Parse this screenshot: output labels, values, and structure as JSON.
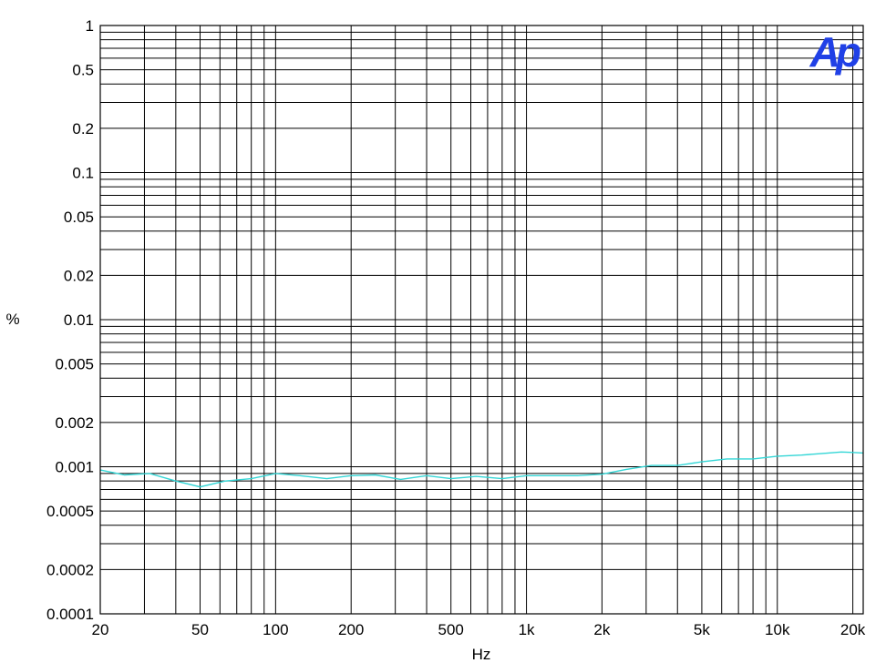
{
  "chart_data": {
    "type": "line",
    "title": "",
    "xlabel": "Hz",
    "ylabel": "%",
    "x_scale": "log",
    "y_scale": "log",
    "xlim": [
      20,
      22000
    ],
    "ylim": [
      0.0001,
      1
    ],
    "grid": true,
    "logo": "Ap",
    "x_ticks": [
      {
        "value": 20,
        "label": "20"
      },
      {
        "value": 50,
        "label": "50"
      },
      {
        "value": 100,
        "label": "100"
      },
      {
        "value": 200,
        "label": "200"
      },
      {
        "value": 500,
        "label": "500"
      },
      {
        "value": 1000,
        "label": "1k"
      },
      {
        "value": 2000,
        "label": "2k"
      },
      {
        "value": 5000,
        "label": "5k"
      },
      {
        "value": 10000,
        "label": "10k"
      },
      {
        "value": 20000,
        "label": "20k"
      }
    ],
    "y_ticks": [
      {
        "value": 1,
        "label": "1"
      },
      {
        "value": 0.5,
        "label": "0.5"
      },
      {
        "value": 0.2,
        "label": "0.2"
      },
      {
        "value": 0.1,
        "label": "0.1"
      },
      {
        "value": 0.05,
        "label": "0.05"
      },
      {
        "value": 0.02,
        "label": "0.02"
      },
      {
        "value": 0.01,
        "label": "0.01"
      },
      {
        "value": 0.005,
        "label": "0.005"
      },
      {
        "value": 0.002,
        "label": "0.002"
      },
      {
        "value": 0.001,
        "label": "0.001"
      },
      {
        "value": 0.0005,
        "label": "0.0005"
      },
      {
        "value": 0.0002,
        "label": "0.0002"
      },
      {
        "value": 0.0001,
        "label": "0.0001"
      }
    ],
    "series": [
      {
        "color": "#33d6d6",
        "x": [
          20,
          25,
          31.5,
          40,
          50,
          63,
          80,
          100,
          125,
          160,
          200,
          250,
          315,
          400,
          500,
          630,
          800,
          1000,
          1250,
          1600,
          2000,
          2500,
          3150,
          4000,
          5000,
          6300,
          8000,
          10000,
          12500,
          16000,
          18000,
          20000,
          22000
        ],
        "y": [
          0.00095,
          0.00088,
          0.0009,
          0.0008,
          0.00073,
          0.0008,
          0.00083,
          0.0009,
          0.00087,
          0.00083,
          0.00087,
          0.00088,
          0.00082,
          0.00087,
          0.00083,
          0.00086,
          0.00083,
          0.00087,
          0.00087,
          0.00087,
          0.00089,
          0.00096,
          0.00102,
          0.00102,
          0.00108,
          0.00113,
          0.00113,
          0.00118,
          0.0012,
          0.00124,
          0.00126,
          0.00125,
          0.00124
        ]
      }
    ]
  }
}
